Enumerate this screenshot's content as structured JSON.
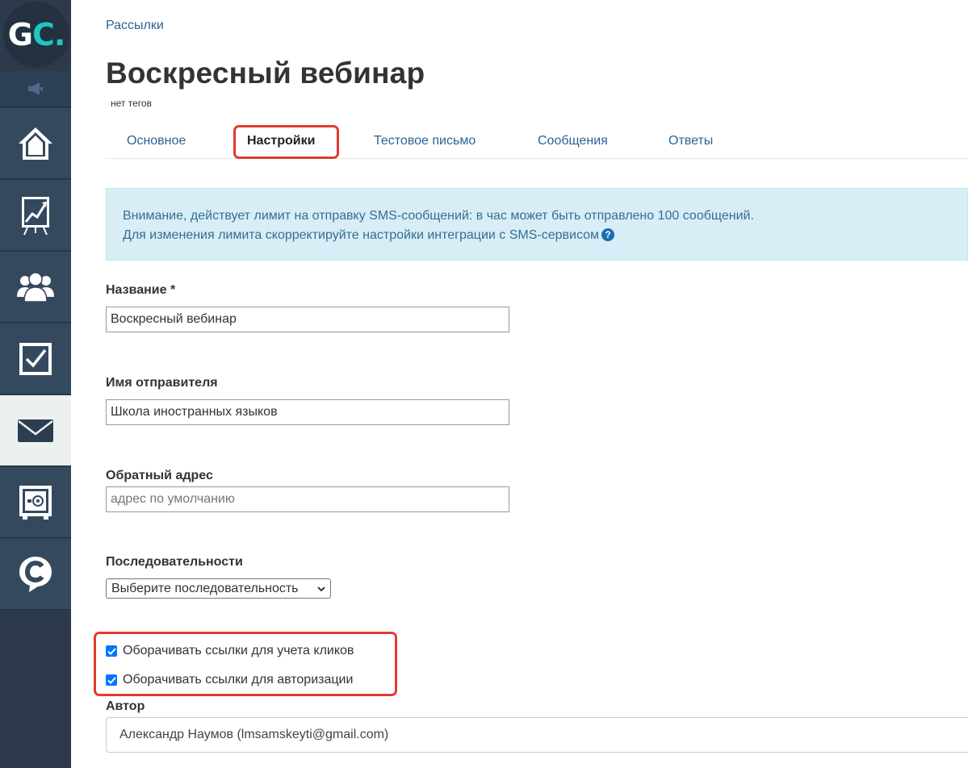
{
  "logo": {
    "text_main": "G",
    "text_accent": "C.",
    "accent_color": "#1fc7c0"
  },
  "sidebar": {
    "items": [
      {
        "name": "home",
        "icon": "home-icon",
        "active": false
      },
      {
        "name": "analytics",
        "icon": "chart-board-icon",
        "active": false
      },
      {
        "name": "users",
        "icon": "users-icon",
        "active": false
      },
      {
        "name": "tasks",
        "icon": "checkbox-icon",
        "active": false
      },
      {
        "name": "mailings",
        "icon": "envelope-icon",
        "active": true
      },
      {
        "name": "sales",
        "icon": "safe-icon",
        "active": false
      },
      {
        "name": "chat",
        "icon": "chat-c-icon",
        "active": false
      }
    ]
  },
  "breadcrumb": "Рассылки",
  "title": "Воскресный вебинар",
  "tags": "нет тегов",
  "tabs": [
    {
      "label": "Основное",
      "active": false
    },
    {
      "label": "Настройки",
      "active": true
    },
    {
      "label": "Тестовое письмо",
      "active": false
    },
    {
      "label": "Сообщения",
      "active": false
    },
    {
      "label": "Ответы",
      "active": false
    }
  ],
  "alert": {
    "line1": "Внимание, действует лимит на отправку SMS-сообщений: в час может быть отправлено 100 сообщений.",
    "line2": "Для изменения лимита скорректируйте настройки интеграции с SMS-сервисом",
    "help_icon": "?"
  },
  "form": {
    "name_label": "Название *",
    "name_value": "Воскресный вебинар",
    "sender_label": "Имя отправителя",
    "sender_value": "Школа иностранных языков",
    "reply_label": "Обратный адрес",
    "reply_value": "",
    "reply_placeholder": "адрес по умолчанию",
    "sequence_label": "Последовательности",
    "sequence_selected": "Выберите последовательность",
    "wrap_clicks_label": "Оборачивать ссылки для учета кликов",
    "wrap_clicks_checked": true,
    "wrap_auth_label": "Оборачивать ссылки для авторизации",
    "wrap_auth_checked": true,
    "author_label": "Автор",
    "author_value": "Александр Наумов (lmsamskeyti@gmail.com)"
  },
  "colors": {
    "sidebar_bg": "#34495e",
    "link": "#2a6496",
    "highlight": "#e03c31",
    "alert_bg": "#d9edf7",
    "alert_text": "#31708f"
  }
}
